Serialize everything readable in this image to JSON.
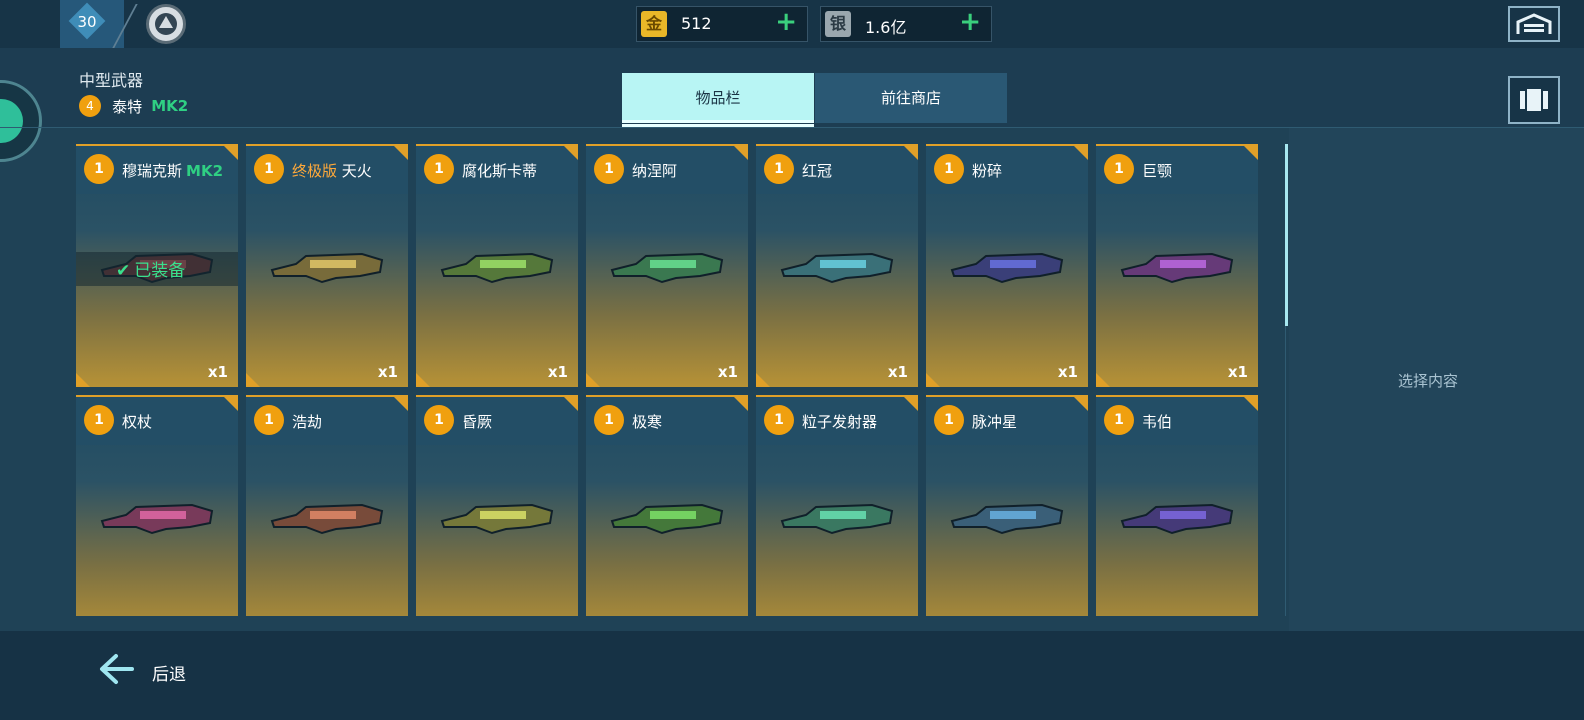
{
  "topbar": {
    "level": "30",
    "gold": {
      "label": "金",
      "value": "512",
      "color": "#e9b728"
    },
    "silver": {
      "label": "银",
      "value": "1.6亿",
      "color": "#9aa7ae"
    },
    "plus": "+"
  },
  "header": {
    "category": "中型武器",
    "weapon_level": "4",
    "weapon_name": "泰特",
    "weapon_mk": "MK2"
  },
  "tabs": [
    {
      "label": "物品栏",
      "active": true
    },
    {
      "label": "前往商店",
      "active": false
    }
  ],
  "items": [
    {
      "level": "1",
      "name": "穆瑞克斯",
      "mk": "MK2",
      "count": "x1",
      "equipped": "已装备",
      "icon": "weapon-equipped"
    },
    {
      "level": "1",
      "prefix": "终极版",
      "name": " 天火",
      "count": "x1",
      "icon": "weapon-tianhuo"
    },
    {
      "level": "1",
      "name": "腐化斯卡蒂",
      "count": "x1",
      "icon": "weapon-skadi"
    },
    {
      "level": "1",
      "name": "纳涅阿",
      "count": "x1",
      "icon": "weapon-nania"
    },
    {
      "level": "1",
      "name": "红冠",
      "count": "x1",
      "icon": "weapon-redcrown"
    },
    {
      "level": "1",
      "name": "粉碎",
      "count": "x1",
      "icon": "weapon-smash"
    },
    {
      "level": "1",
      "name": "巨颚",
      "count": "x1",
      "icon": "weapon-jaw"
    },
    {
      "level": "1",
      "name": "权杖",
      "count": "",
      "icon": "weapon-scepter"
    },
    {
      "level": "1",
      "name": "浩劫",
      "count": "",
      "icon": "weapon-havoc"
    },
    {
      "level": "1",
      "name": "昏厥",
      "count": "",
      "icon": "weapon-faint"
    },
    {
      "level": "1",
      "name": "极寒",
      "count": "",
      "icon": "weapon-frost"
    },
    {
      "level": "1",
      "name": "粒子发射器",
      "count": "",
      "icon": "weapon-particle"
    },
    {
      "level": "1",
      "name": "脉冲星",
      "count": "",
      "icon": "weapon-pulsar"
    },
    {
      "level": "1",
      "name": "韦伯",
      "count": "",
      "icon": "weapon-weber"
    }
  ],
  "right_panel": {
    "placeholder": "选择内容"
  },
  "footer": {
    "back_label": "后退"
  },
  "colors": {
    "accent": "#b8f5f4",
    "badge": "#f0a00f",
    "mk_green": "#2fd083",
    "card_border": "#e0a028"
  }
}
